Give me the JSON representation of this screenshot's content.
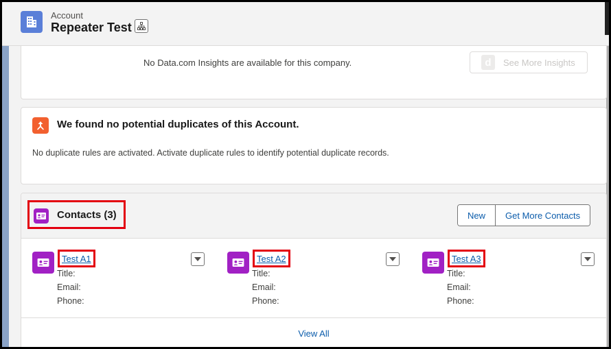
{
  "header": {
    "object_label": "Account",
    "record_name": "Repeater Test",
    "icon": "account-building-icon"
  },
  "insights": {
    "message": "No Data.com Insights are available for this company.",
    "button_label": "See More Insights",
    "button_logo": "d"
  },
  "duplicates": {
    "title": "We found no potential duplicates of this Account.",
    "message": "No duplicate rules are activated. Activate duplicate rules to identify potential duplicate records."
  },
  "contacts": {
    "title": "Contacts (3)",
    "buttons": {
      "new": "New",
      "get_more": "Get More Contacts"
    },
    "items": [
      {
        "name": "Test A1",
        "title_label": "Title:",
        "email_label": "Email:",
        "phone_label": "Phone:"
      },
      {
        "name": "Test A2",
        "title_label": "Title:",
        "email_label": "Email:",
        "phone_label": "Phone:"
      },
      {
        "name": "Test A3",
        "title_label": "Title:",
        "email_label": "Email:",
        "phone_label": "Phone:"
      }
    ],
    "view_all": "View All"
  },
  "colors": {
    "account_icon": "#5a7fd8",
    "duplicate_icon": "#f2602f",
    "contact_icon": "#a121c4",
    "link": "#0b5cab",
    "highlight": "#e3000f"
  }
}
